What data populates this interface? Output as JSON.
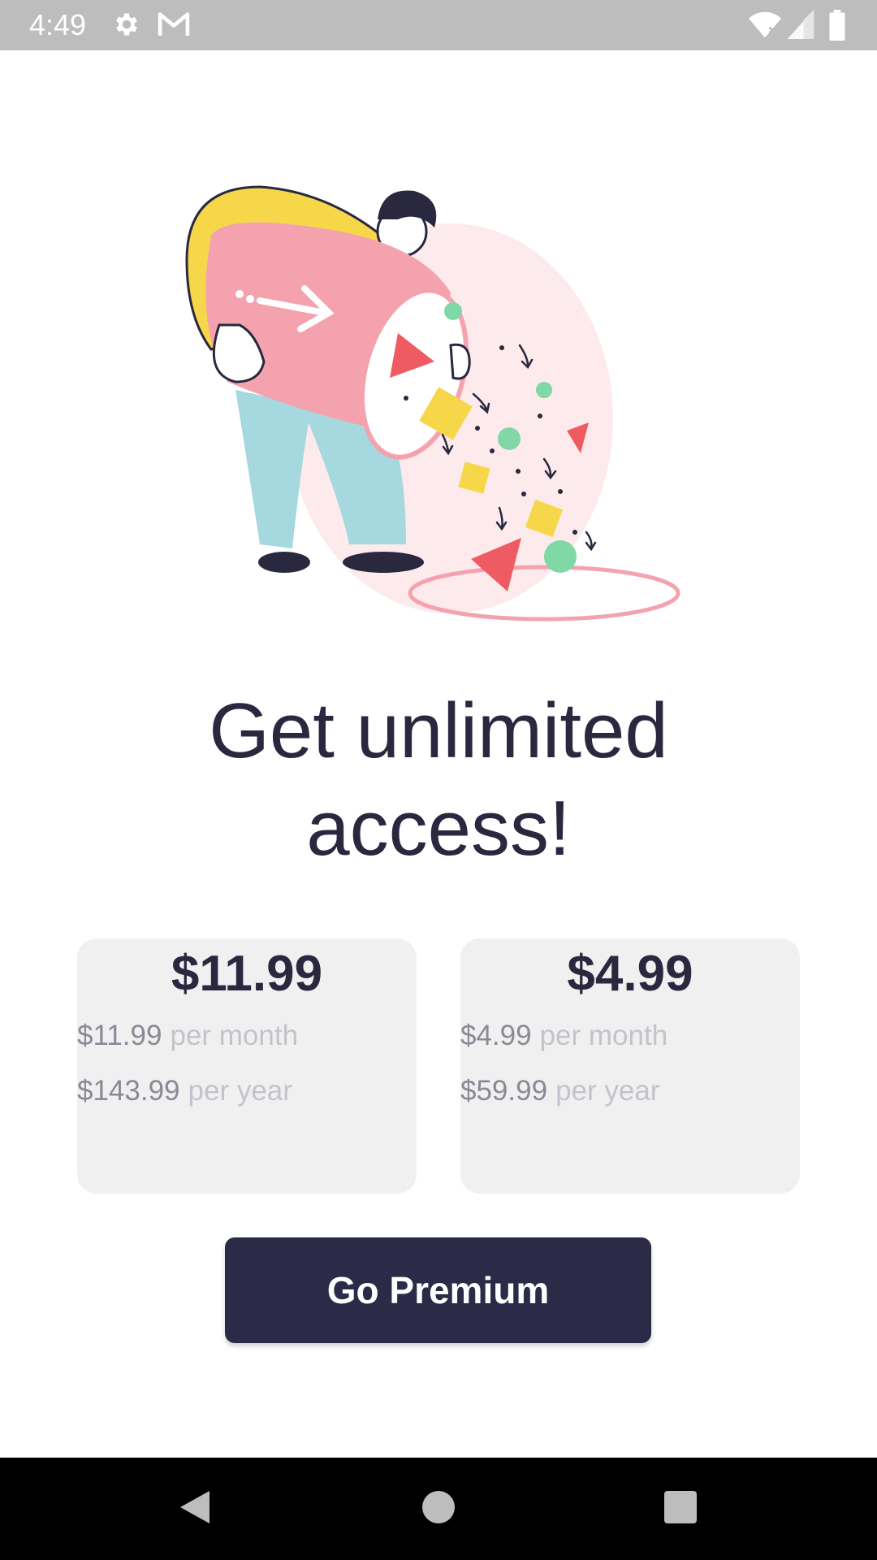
{
  "status_bar": {
    "time": "4:49",
    "icons": [
      "settings-icon",
      "gmail-icon",
      "wifi-icon",
      "signal-icon",
      "battery-icon"
    ]
  },
  "illustration": {
    "icon": "person-pouring-shapes-illustration",
    "colors": {
      "yellow": "#f7d74a",
      "pink": "#f4a3ae",
      "blue": "#a5d8df",
      "navy": "#29283f",
      "green": "#7fd8a5",
      "red": "#ef5b63"
    }
  },
  "headline": {
    "line1": "Get unlimited",
    "line2": "access!"
  },
  "plans": [
    {
      "price": "$11.99",
      "monthly_amount": "$11.99",
      "monthly_unit": "per month",
      "yearly_amount": "$143.99",
      "yearly_unit": "per year"
    },
    {
      "price": "$4.99",
      "monthly_amount": "$4.99",
      "monthly_unit": "per month",
      "yearly_amount": "$59.99",
      "yearly_unit": "per year"
    }
  ],
  "cta": {
    "label": "Go Premium"
  },
  "nav_bar": {
    "icons": [
      "back-icon",
      "home-icon",
      "recents-icon"
    ]
  },
  "colors": {
    "accent": "#2b2a47",
    "card_bg": "#f0f0f0",
    "status_bar_bg": "#bdbdbd"
  }
}
